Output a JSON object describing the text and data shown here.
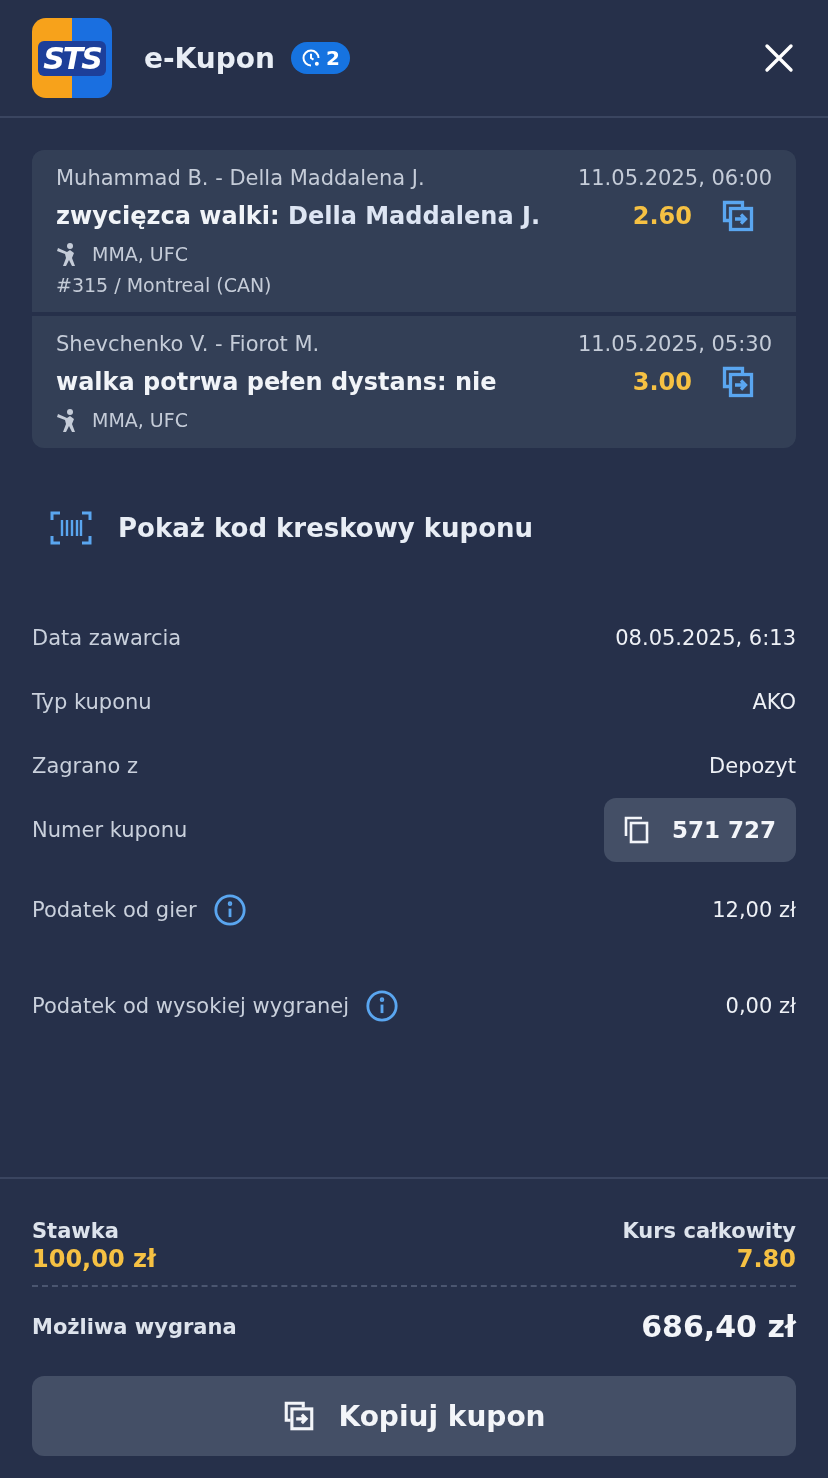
{
  "header": {
    "logo": "STS",
    "title": "e-Kupon",
    "badge": "2"
  },
  "events": [
    {
      "match": "Muhammad B. - Della Maddalena J.",
      "datetime": "11.05.2025, 06:00",
      "selection": "zwycięzca walki: **Della Maddalena J.**",
      "odds": "2.60",
      "sport": "MMA, UFC",
      "venue": "#315 / Montreal (CAN)"
    },
    {
      "match": "Shevchenko V. - Fiorot M.",
      "datetime": "11.05.2025, 05:30",
      "selection": "walka potrwa pełen dystans: nie",
      "odds": "3.00",
      "sport": "MMA, UFC"
    }
  ],
  "barcode_link": "Pokaż kod kreskowy kuponu",
  "details": [
    {
      "kind": "text",
      "label": "Data zawarcia",
      "value": "08.05.2025, 6:13"
    },
    {
      "kind": "text",
      "label": "Typ kuponu",
      "value": "AKO"
    },
    {
      "kind": "text",
      "label": "Zagrano z",
      "value": "Depozyt"
    },
    {
      "kind": "copy",
      "label": "Numer kuponu",
      "value": "571 727"
    },
    {
      "kind": "info",
      "label": "Podatek od gier",
      "value": "12,00 zł"
    },
    {
      "kind": "info",
      "label": "Podatek od wysokiej wygranej",
      "value": "0,00 zł"
    }
  ],
  "summary": {
    "stake_label": "Stawka",
    "stake": "100,00 zł",
    "odds_label": "Kurs całkowity",
    "odds": "7.80",
    "win_label": "Możliwa wygrana",
    "win": "686,40 zł"
  },
  "copy_button": "Kopiuj kupon"
}
